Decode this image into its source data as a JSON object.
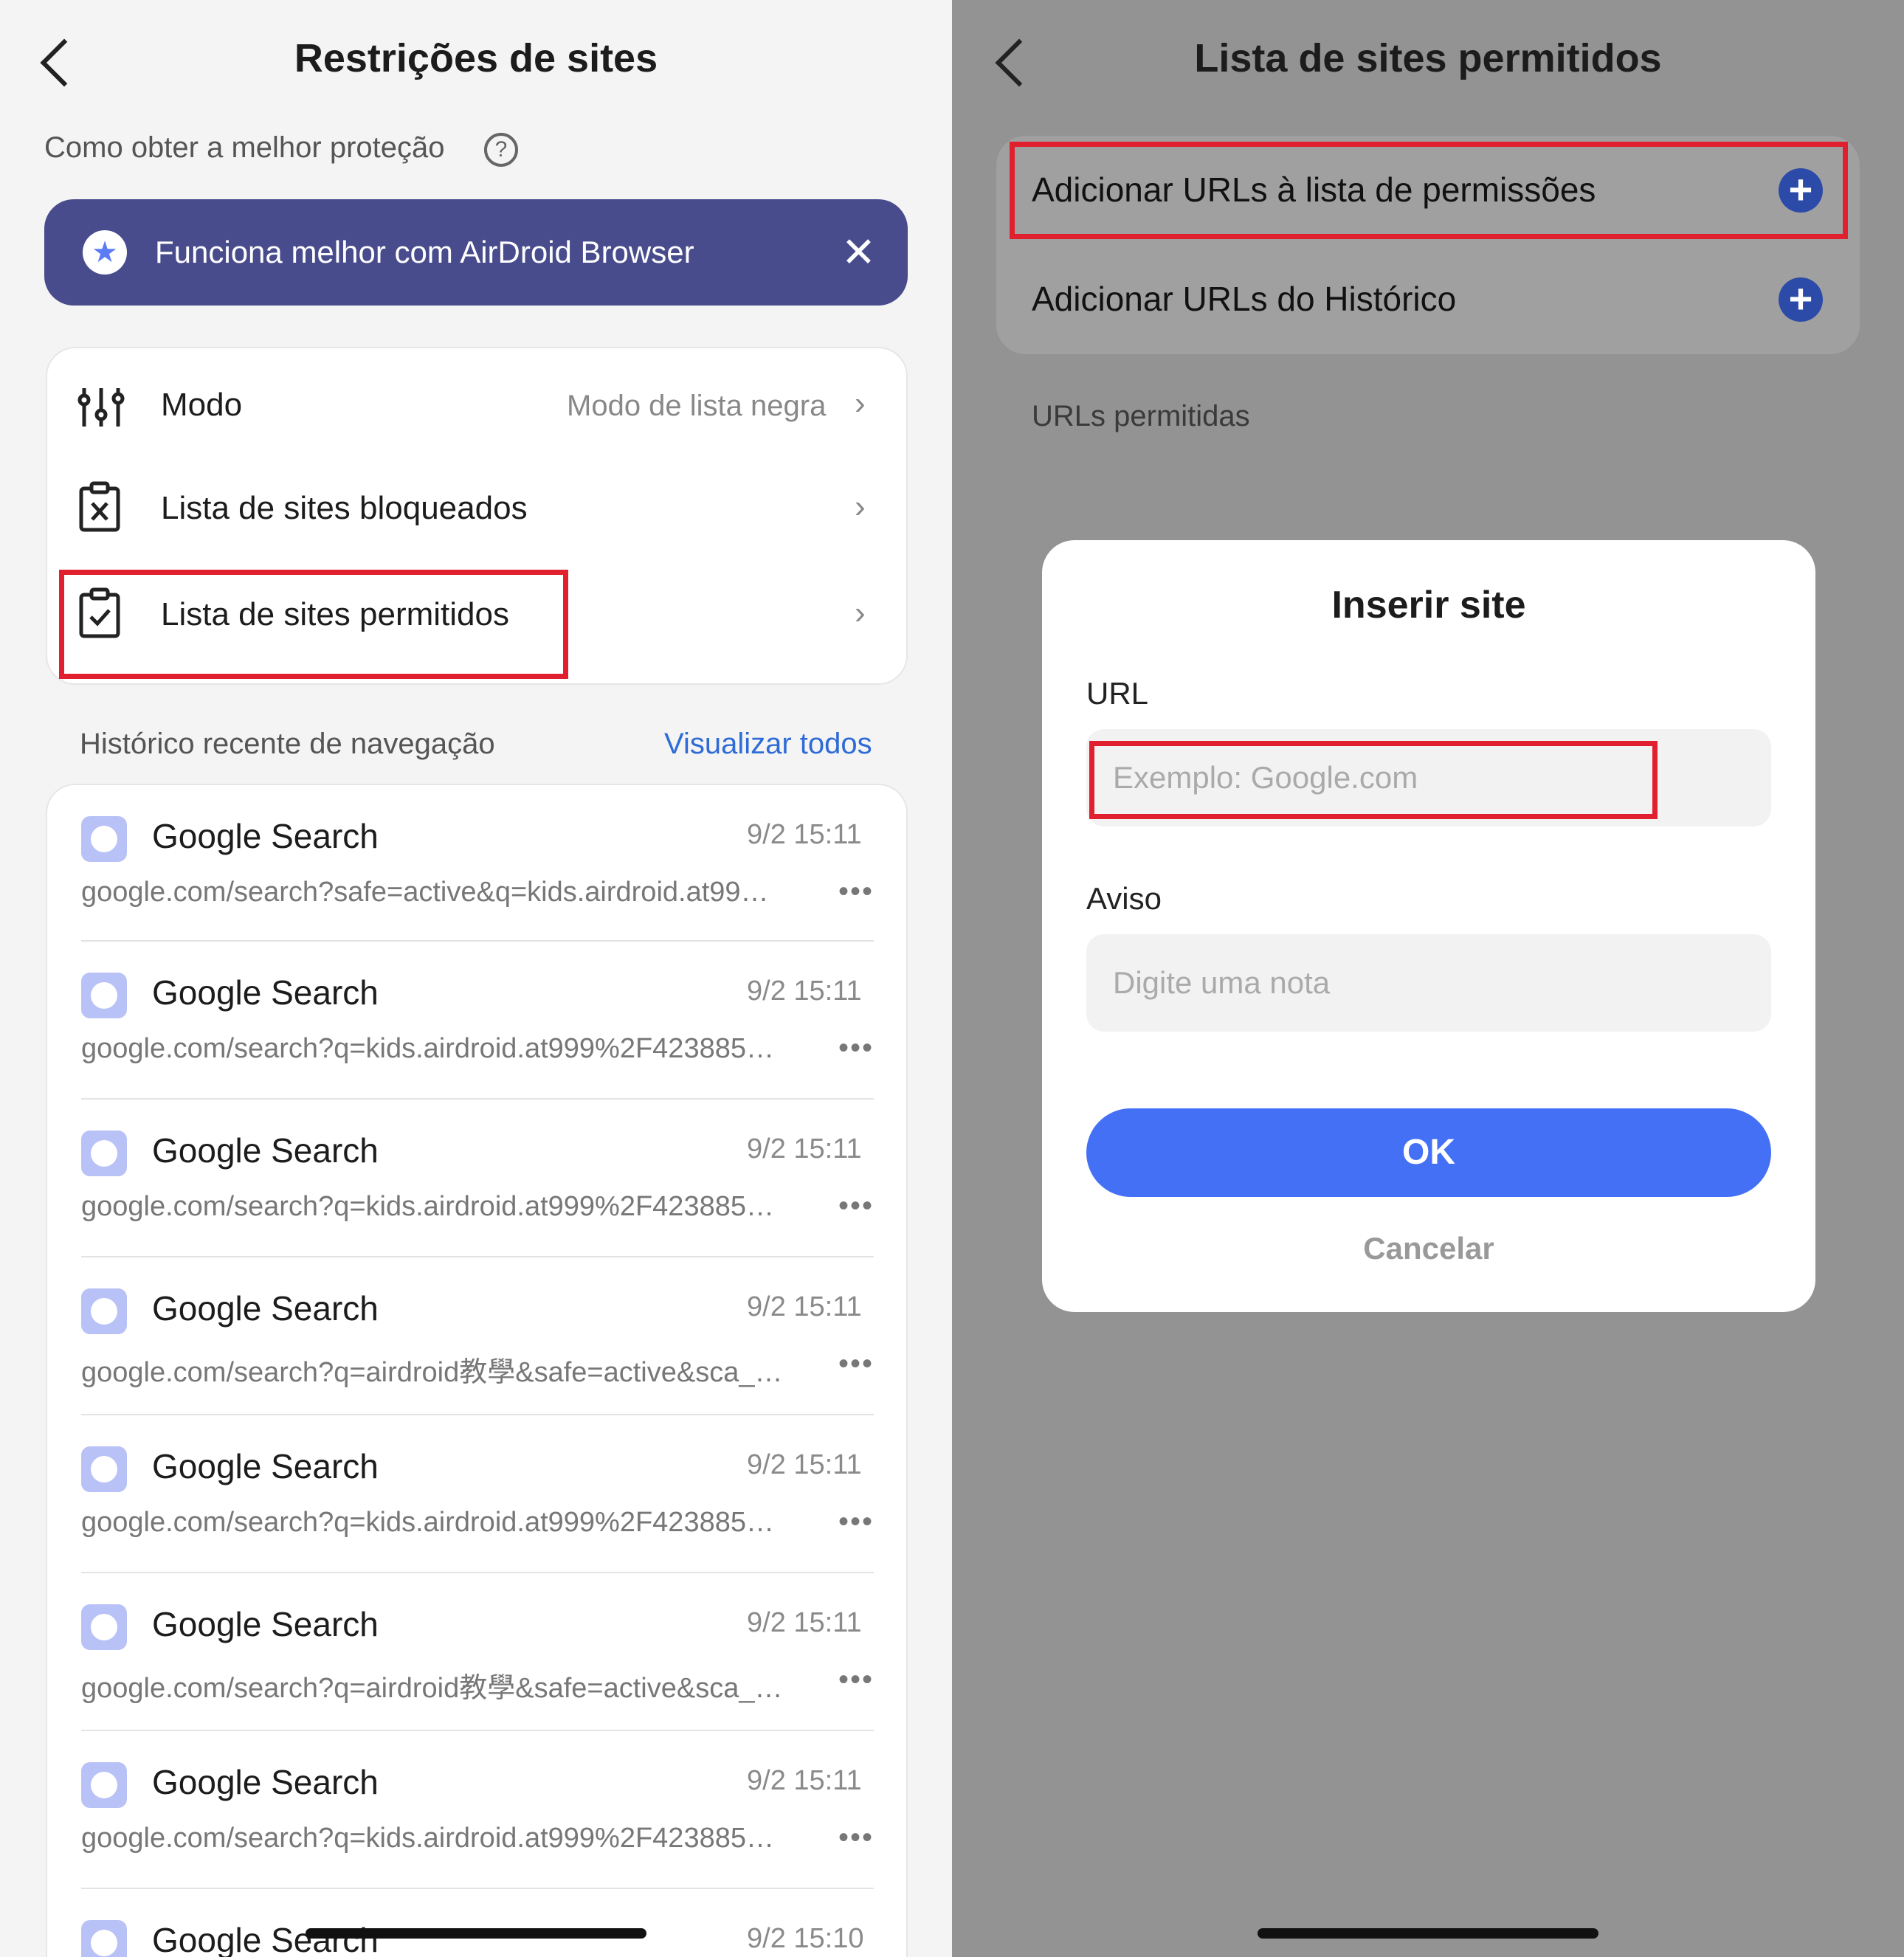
{
  "left": {
    "title": "Restrições de sites",
    "hint": "Como obter a melhor proteção",
    "banner": {
      "text": "Funciona melhor com AirDroid Browser"
    },
    "menu": [
      {
        "label": "Modo",
        "value": "Modo de lista negra"
      },
      {
        "label": "Lista de sites bloqueados",
        "value": ""
      },
      {
        "label": "Lista de sites permitidos",
        "value": ""
      }
    ],
    "history_label": "Histórico recente de navegação",
    "view_all": "Visualizar todos",
    "history": [
      {
        "title": "Google Search",
        "time": "9/2 15:11",
        "url": "google.com/search?safe=active&q=kids.airdroid.at99…"
      },
      {
        "title": "Google Search",
        "time": "9/2 15:11",
        "url": "google.com/search?q=kids.airdroid.at999%2F423885…"
      },
      {
        "title": "Google Search",
        "time": "9/2 15:11",
        "url": "google.com/search?q=kids.airdroid.at999%2F423885…"
      },
      {
        "title": "Google Search",
        "time": "9/2 15:11",
        "url": "google.com/search?q=airdroid教學&safe=active&sca_…"
      },
      {
        "title": "Google Search",
        "time": "9/2 15:11",
        "url": "google.com/search?q=kids.airdroid.at999%2F423885…"
      },
      {
        "title": "Google Search",
        "time": "9/2 15:11",
        "url": "google.com/search?q=airdroid教學&safe=active&sca_…"
      },
      {
        "title": "Google Search",
        "time": "9/2 15:11",
        "url": "google.com/search?q=kids.airdroid.at999%2F423885…"
      },
      {
        "title": "Google Search",
        "time": "9/2 15:10",
        "url": ""
      }
    ],
    "more_glyph": "•••"
  },
  "right": {
    "title": "Lista de sites permitidos",
    "add_whitelist": "Adicionar URLs à lista de permissões",
    "add_history": "Adicionar URLs do Histórico",
    "allowed_label": "URLs permitidas",
    "modal": {
      "title": "Inserir site",
      "url_label": "URL",
      "url_placeholder": "Exemplo: Google.com",
      "note_label": "Aviso",
      "note_placeholder": "Digite uma nota",
      "ok": "OK",
      "cancel": "Cancelar"
    }
  },
  "colors": {
    "accent": "#4470f6",
    "banner": "#494c8c",
    "highlight": "#e0202e",
    "link": "#2f6bd6"
  }
}
